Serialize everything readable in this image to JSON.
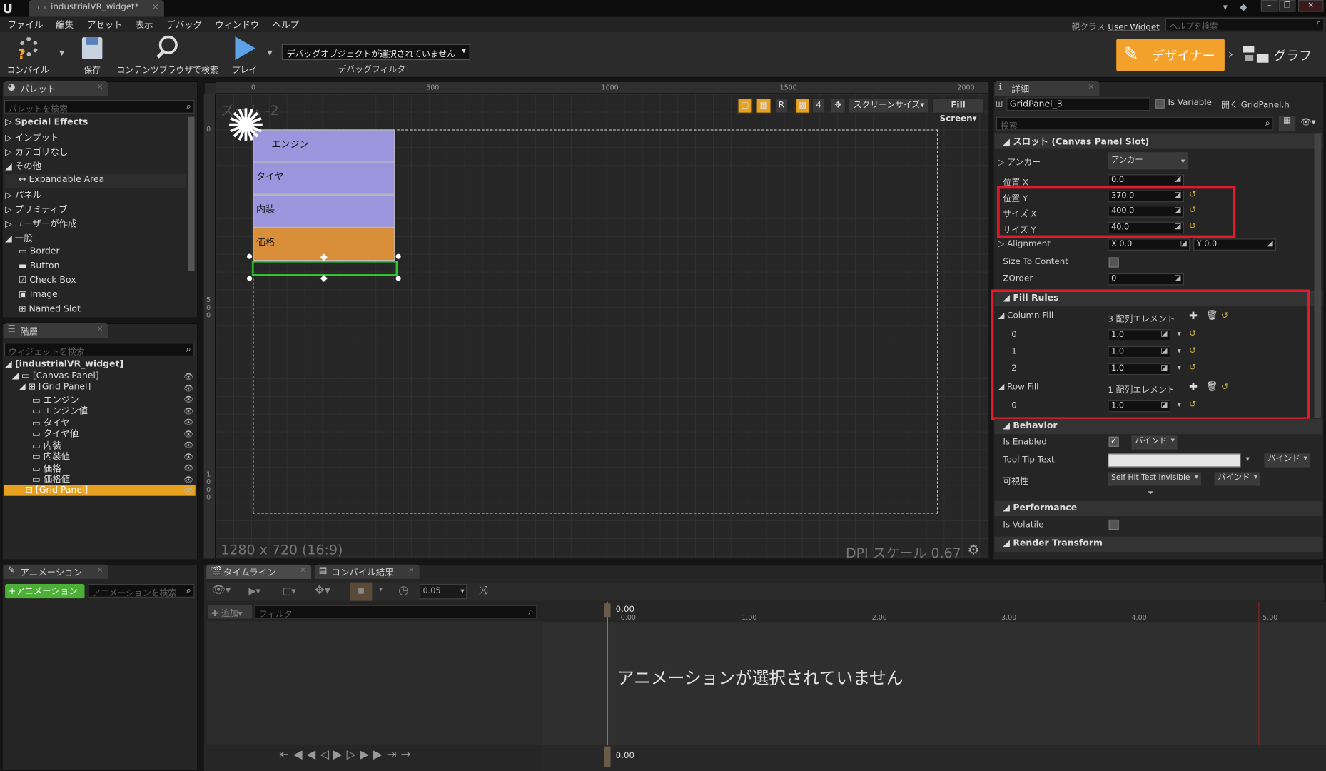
{
  "window": {
    "tab_title": "industrialVR_widget*",
    "parent_class_label": "親クラス",
    "parent_class_value": "User Widget",
    "help_placeholder": "ヘルプを検索"
  },
  "menu": [
    "ファイル",
    "編集",
    "アセット",
    "表示",
    "デバッグ",
    "ウィンドウ",
    "ヘルプ"
  ],
  "toolbar": {
    "compile": "コンパイル",
    "save": "保存",
    "browse": "コンテンツブラウザで検索",
    "play": "プレイ",
    "debug_select": "デバッグオブジェクトが選択されていません",
    "debug_filter": "デバッグフィルター",
    "designer": "デザイナー",
    "graph": "グラフ"
  },
  "palette": {
    "tab": "パレット",
    "search_placeholder": "パレットを検索",
    "items": [
      "Special Effects",
      "インプット",
      "カテゴリなし",
      "その他",
      "Expandable Area",
      "パネル",
      "プリミティブ",
      "ユーザーが作成",
      "一般",
      "Border",
      "Button",
      "Check Box",
      "Image",
      "Named Slot"
    ]
  },
  "hierarchy": {
    "tab": "階層",
    "search_placeholder": "ウィジェットを検索",
    "items": [
      "[industrialVR_widget]",
      "[Canvas Panel]",
      "[Grid Panel]",
      "エンジン",
      "エンジン値",
      "タイヤ",
      "タイヤ値",
      "内装",
      "内装値",
      "価格",
      "価格値",
      "[Grid Panel]"
    ]
  },
  "canvas": {
    "zoom": "ズーム -2",
    "ruler_top": [
      "0",
      "500",
      "1000",
      "1500",
      "2000"
    ],
    "ruler_left": [
      "0",
      "5",
      "0",
      "0",
      "1",
      "0",
      "0",
      "0"
    ],
    "cells": [
      "エンジン",
      "タイヤ",
      "内装",
      "価格"
    ],
    "toolbar": {
      "r": "R",
      "four": "4",
      "screen_size": "スクリーンサイズ",
      "fill_screen": "Fill Screen"
    },
    "resolution": "1280 x 720 (16:9)",
    "dpi": "DPI スケール 0.67"
  },
  "details": {
    "tab": "詳細",
    "name_value": "GridPanel_3",
    "is_variable": "Is Variable",
    "open_link": "開く GridPanel.h",
    "search_placeholder": "検索",
    "slot_header": "スロット (Canvas Panel Slot)",
    "anchor_label": "アンカー",
    "anchor_value": "アンカー",
    "pos_x_label": "位置 X",
    "pos_x": "0.0",
    "pos_y_label": "位置 Y",
    "pos_y": "370.0",
    "size_x_label": "サイズ X",
    "size_x": "400.0",
    "size_y_label": "サイズ Y",
    "size_y": "40.0",
    "alignment_label": "Alignment",
    "alignment_x": "X 0.0",
    "alignment_y": "Y 0.0",
    "size_to_content": "Size To Content",
    "zorder_label": "ZOrder",
    "zorder": "0",
    "fill_rules": "Fill Rules",
    "column_fill": "Column Fill",
    "column_fill_count": "3 配列エレメント",
    "column_fill_items": [
      {
        "index": "0",
        "value": "1.0"
      },
      {
        "index": "1",
        "value": "1.0"
      },
      {
        "index": "2",
        "value": "1.0"
      }
    ],
    "row_fill": "Row Fill",
    "row_fill_count": "1 配列エレメント",
    "row_fill_items": [
      {
        "index": "0",
        "value": "1.0"
      }
    ],
    "behavior": "Behavior",
    "is_enabled": "Is Enabled",
    "bind": "バインド",
    "tooltip": "Tool Tip Text",
    "visibility_label": "可視性",
    "visibility_value": "Self Hit Test Invisible",
    "performance": "Performance",
    "is_volatile": "Is Volatile",
    "render_transform": "Render Transform"
  },
  "animation": {
    "tab": "アニメーション",
    "add_button": "+アニメーション",
    "search_placeholder": "アニメーションを検索"
  },
  "timeline": {
    "tab_timeline": "タイムライン",
    "tab_compile": "コンパイル結果",
    "step_value": "0.05",
    "add_button": "追加",
    "filter_placeholder": "フィルタ",
    "ticks": [
      "0.00",
      "1.00",
      "2.00",
      "3.00",
      "4.00",
      "5.00"
    ],
    "current_time": "0.00",
    "empty_message": "アニメーションが選択されていません"
  },
  "colors": {
    "accent": "#f3a12a",
    "highlight_red": "#e5192c",
    "cell_purple": "#9a95dc",
    "cell_orange": "#d98f3a",
    "selection": "#e8a11f"
  }
}
